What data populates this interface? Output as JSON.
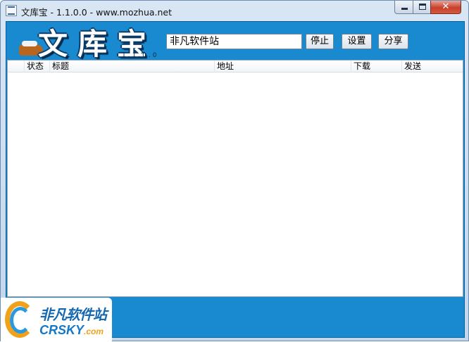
{
  "window": {
    "title": "文库宝 - 1.1.0.0 - www.mozhua.net",
    "controls": {
      "minimize": "minimize",
      "maximize": "maximize",
      "close": "✕"
    }
  },
  "logo": {
    "text": "文库宝",
    "version": "1.1.0.0"
  },
  "toolbar": {
    "search_value": "非凡软件站",
    "stop_label": "停止",
    "settings_label": "设置",
    "share_label": "分享"
  },
  "list": {
    "columns": [
      "",
      "状态",
      "标题",
      "地址",
      "下载",
      "发送"
    ],
    "rows": []
  },
  "watermark": {
    "cn": "非凡软件站",
    "en_main": "CRSKY",
    "en_suffix": ".com"
  },
  "colors": {
    "accent": "#1a8ad0",
    "watermark_orange": "#f2a11a",
    "watermark_blue": "#1668b2"
  }
}
